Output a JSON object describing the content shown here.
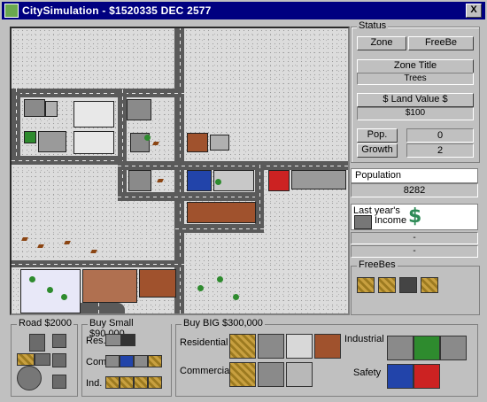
{
  "window": {
    "title": "CitySimulation - $1520335  DEC 2577",
    "close_label": "X"
  },
  "status": {
    "legend": "Status",
    "zone_button": "Zone",
    "freebe_button": "FreeBe",
    "zone_title_label": "Zone Title",
    "zone_title_value": "Trees",
    "land_value_label": "$ Land Value $",
    "land_value_value": "$100",
    "pop_label": "Pop.",
    "pop_value": "0",
    "growth_label": "Growth",
    "growth_value": "2"
  },
  "population": {
    "label": "Population",
    "value": "8282"
  },
  "income": {
    "label_line1": "Last year's",
    "label_line2": "Income",
    "icon": "dollar-icon",
    "value_line1": "-",
    "value_line2": "-"
  },
  "freebes": {
    "legend": "FreeBes",
    "items": [
      "tree-tile",
      "tree-tile",
      "bin-tile",
      "grass-tile"
    ]
  },
  "road_group": {
    "legend": "Road $2000"
  },
  "buy_small": {
    "legend": "Buy Small $90,000",
    "res_label": "Res.",
    "com_label": "Com.",
    "ind_label": "Ind."
  },
  "buy_big": {
    "legend": "Buy BIG $300,000",
    "residential_label": "Residential",
    "commercial_label": "Commercial",
    "industrial_label": "Industrial",
    "safety_label": "Safety"
  },
  "colors": {
    "titlebar": "#000080",
    "window": "#c0c0c0",
    "dollar": "#2e8b57"
  }
}
